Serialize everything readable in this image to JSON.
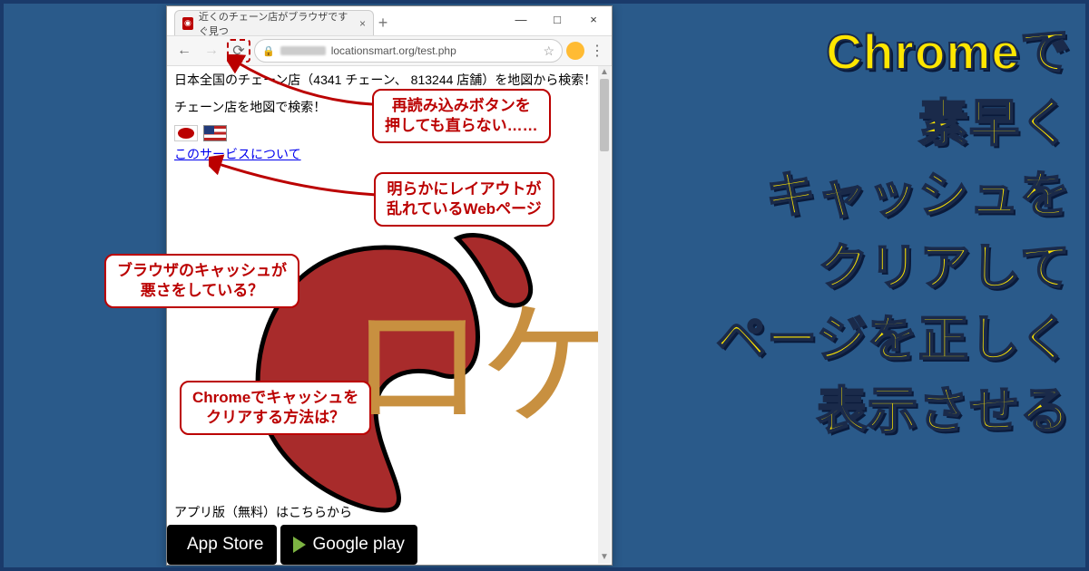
{
  "window": {
    "tab_title": "近くのチェーン店がブラウザですぐ見つ",
    "minimize": "—",
    "maximize": "□",
    "close": "×"
  },
  "addressbar": {
    "url_visible": "locationsmart.org/test.php"
  },
  "page": {
    "line1": "日本全国のチェーン店（4341 チェーン、 813244 店舗）を地図から検索！",
    "line2": "チェーン店を地図で検索！",
    "service_link": "このサービスについて",
    "big_text": "ロケ",
    "app_line": "アプリ版（無料）はこちらから",
    "appstore": "App Store",
    "googleplay": "Google play"
  },
  "callouts": {
    "c1": "再読み込みボタンを\n押しても直らない……",
    "c2": "明らかにレイアウトが\n乱れているWebページ",
    "c3": "ブラウザのキャッシュが\n悪さをしている？",
    "c4": "Chromeでキャッシュを\nクリアする方法は？"
  },
  "headline": {
    "l1": "Chromeで",
    "l2": "素早く",
    "l3": "キャッシュを",
    "l4": "クリアして",
    "l5": "ページを正しく",
    "l6": "表示させる"
  }
}
